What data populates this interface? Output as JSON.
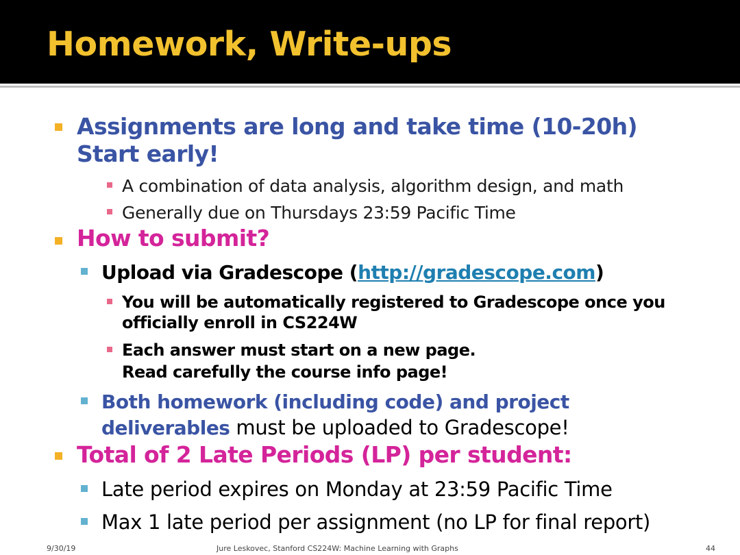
{
  "slide": {
    "title": "Homework, Write-ups",
    "assignments": {
      "line1": "Assignments are long and take time (10-20h)",
      "line2": "Start early!",
      "sub1": "A combination of data analysis, algorithm design, and math",
      "sub2": "Generally due on Thursdays 23:59 Pacific Time"
    },
    "submit": {
      "heading": "How to submit?",
      "upload_prefix": "Upload via Gradescope (",
      "upload_link": "http://gradescope.com",
      "upload_suffix": ")",
      "reg_line1": "You will be automatically registered to Gradescope once you",
      "reg_line2": "officially enroll in CS224W",
      "answer_line1": "Each answer must start on a new page.",
      "answer_line2": "Read carefully the course info page!",
      "both_line1": "Both homework (including code) and project",
      "both_line2_bold": "deliverables",
      "both_line2_rest": " must be uploaded to Gradescope!"
    },
    "late": {
      "heading": "Total of 2 Late Periods (LP) per student:",
      "item1": "Late period expires on Monday at 23:59 Pacific Time",
      "item2": "Max 1 late period per assignment (no LP for final report)"
    },
    "footer": {
      "date": "9/30/19",
      "center": "Jure Leskovec, Stanford CS224W: Machine Learning with Graphs",
      "page": "44"
    }
  },
  "colors": {
    "title": "#f2c12e",
    "blue_heading": "#3a54a4",
    "magenta_heading": "#d4249a",
    "bullet_level1": "#f4b126",
    "bullet_level2": "#62b2cf",
    "bullet_level3": "#e9688a"
  }
}
